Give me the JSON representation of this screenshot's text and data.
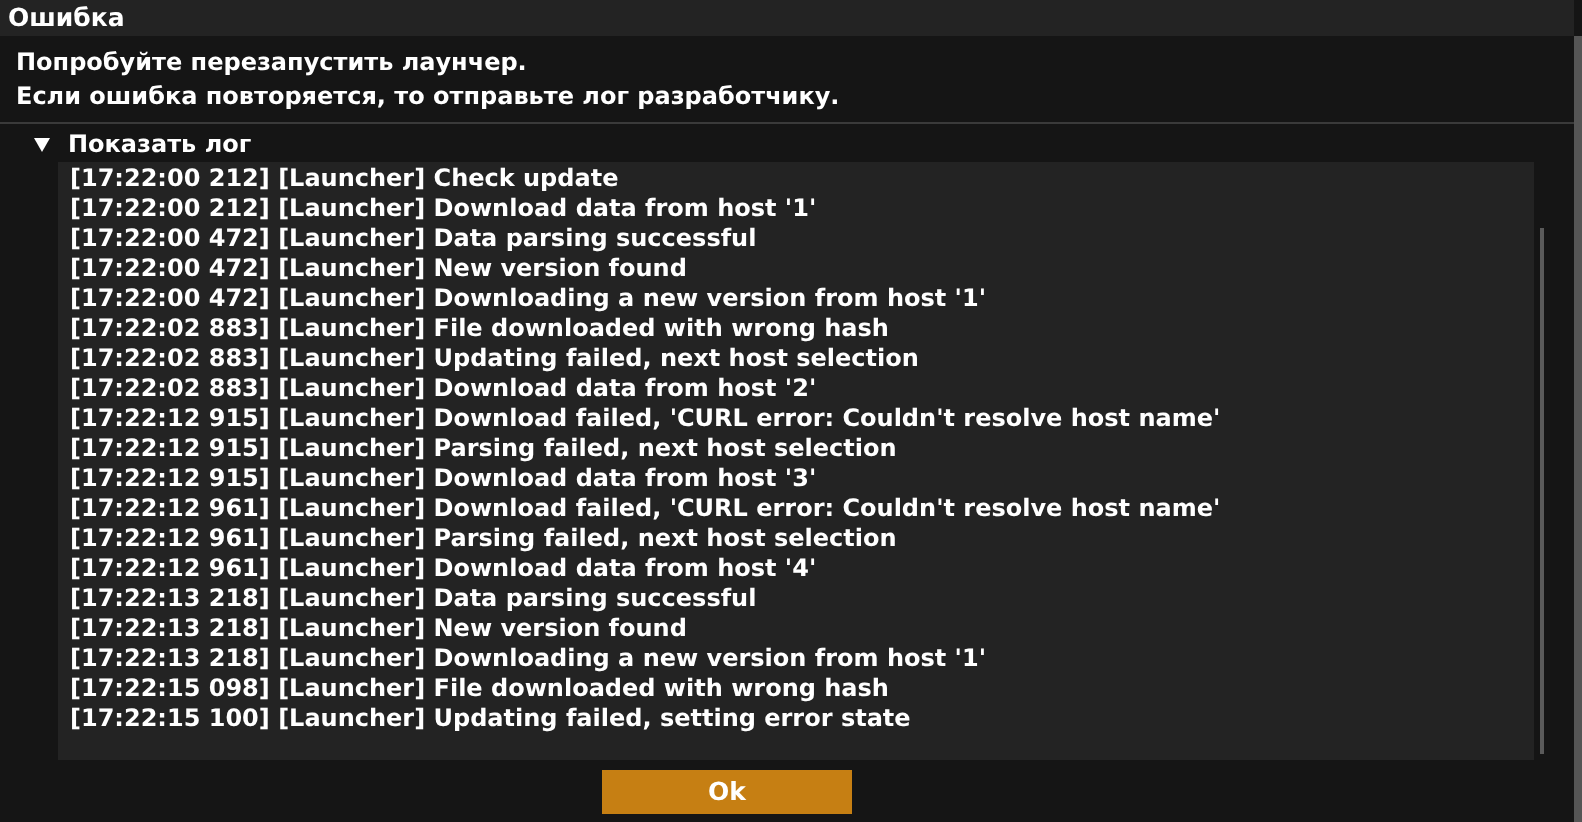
{
  "window": {
    "title": "Ошибка"
  },
  "message": [
    "Попробуйте перезапустить лаунчер.",
    "Если ошибка повторяется, то отправьте лог разработчику."
  ],
  "log_toggle": {
    "label": "Показать лог",
    "expanded": true
  },
  "log": [
    "[17:22:00 212] [Launcher] Check update",
    "[17:22:00 212] [Launcher] Download data from host '1'",
    "[17:22:00 472] [Launcher] Data parsing successful",
    "[17:22:00 472] [Launcher] New version found",
    "[17:22:00 472] [Launcher] Downloading a new version from host '1'",
    "[17:22:02 883] [Launcher] File downloaded with wrong hash",
    "[17:22:02 883] [Launcher] Updating failed, next host selection",
    "[17:22:02 883] [Launcher] Download data from host '2'",
    "[17:22:12 915] [Launcher] Download failed, 'CURL error: Couldn't resolve host name'",
    "[17:22:12 915] [Launcher] Parsing failed, next host selection",
    "[17:22:12 915] [Launcher] Download data from host '3'",
    "[17:22:12 961] [Launcher] Download failed, 'CURL error: Couldn't resolve host name'",
    "[17:22:12 961] [Launcher] Parsing failed, next host selection",
    "[17:22:12 961] [Launcher] Download data from host '4'",
    "[17:22:13 218] [Launcher] Data parsing successful",
    "[17:22:13 218] [Launcher] New version found",
    "[17:22:13 218] [Launcher] Downloading a new version from host '1'",
    "[17:22:15 098] [Launcher] File downloaded with wrong hash",
    "[17:22:15 100] [Launcher] Updating failed, setting error state"
  ],
  "buttons": [
    "Ok"
  ]
}
